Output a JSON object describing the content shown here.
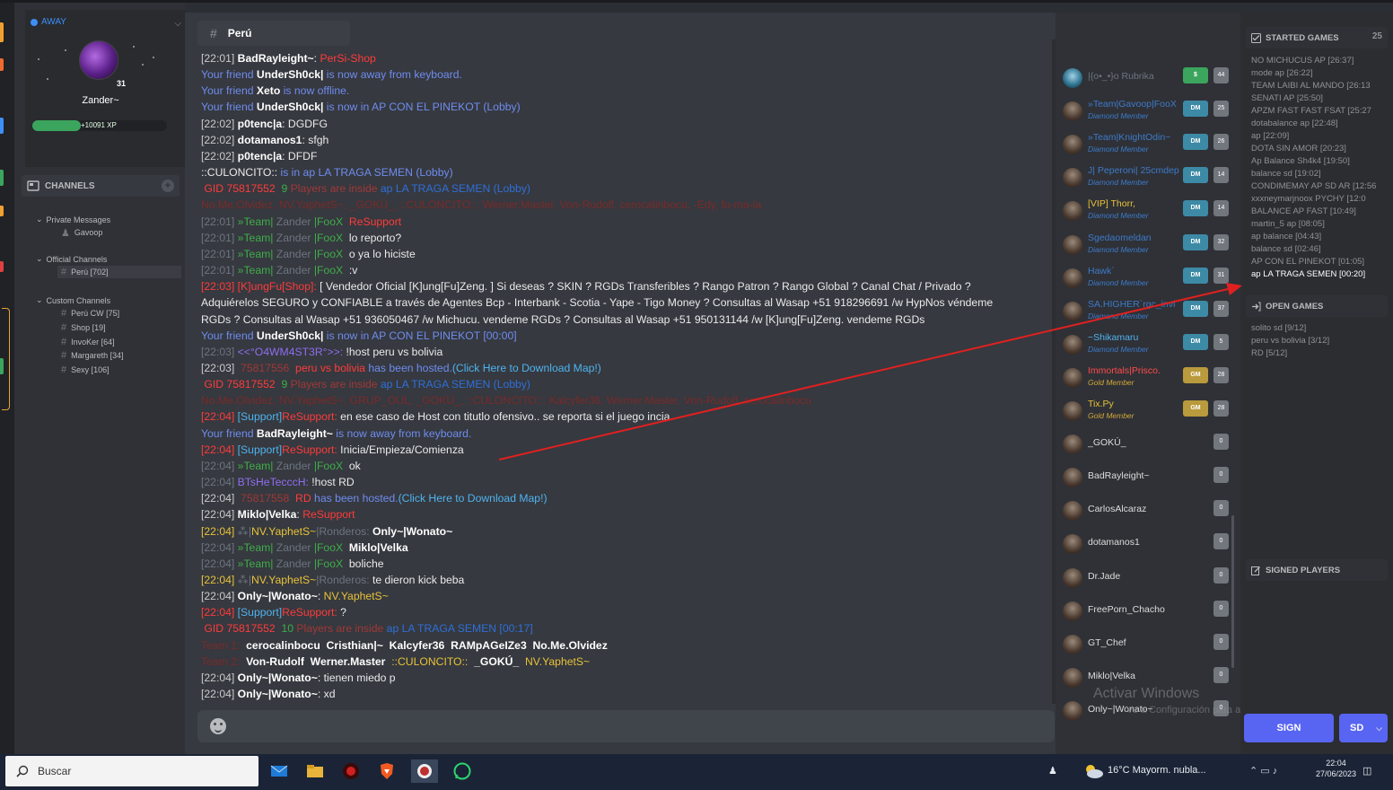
{
  "user": {
    "status": "AWAY",
    "name": "Zander~",
    "level": "31",
    "xp_text": "+10091 XP",
    "xp_fraction": 0.36
  },
  "sidebar": {
    "channels_label": "CHANNELS",
    "private_label": "Private Messages",
    "private_items": [
      {
        "label": "Gavoop"
      }
    ],
    "official_label": "Official Channels",
    "official_items": [
      {
        "label": "Perú [702]"
      }
    ],
    "custom_label": "Custom Channels",
    "custom_items": [
      {
        "label": "Perú CW [75]"
      },
      {
        "label": "Shop [19]"
      },
      {
        "label": "InvoKer [64]"
      },
      {
        "label": "Margareth [34]"
      },
      {
        "label": "Sexy [106]"
      }
    ]
  },
  "chat": {
    "channel_name": "Perú",
    "lines": [
      [
        {
          "t": "[22:01] ",
          "c": "c-time"
        },
        {
          "t": "BadRayleight~",
          "c": "c-bold"
        },
        {
          "t": ": ",
          "c": "c-white"
        },
        {
          "t": "PerSi-Shop",
          "c": "c-red"
        }
      ],
      [
        {
          "t": "Your friend ",
          "c": "c-blue"
        },
        {
          "t": "UnderSh0ck|",
          "c": "c-bold"
        },
        {
          "t": " is now away from keyboard.",
          "c": "c-blue"
        }
      ],
      [
        {
          "t": "Your friend ",
          "c": "c-blue"
        },
        {
          "t": "Xeto",
          "c": "c-bold"
        },
        {
          "t": " is now offline.",
          "c": "c-blue"
        }
      ],
      [
        {
          "t": "Your friend ",
          "c": "c-blue"
        },
        {
          "t": "UnderSh0ck|",
          "c": "c-bold"
        },
        {
          "t": " is now in AP CON EL PINEKOT (Lobby)",
          "c": "c-blue"
        }
      ],
      [
        {
          "t": "[22:02] ",
          "c": "c-time"
        },
        {
          "t": "p0tenc|a",
          "c": "c-bold"
        },
        {
          "t": ": DGDFG",
          "c": "c-white"
        }
      ],
      [
        {
          "t": "[22:02] ",
          "c": "c-time"
        },
        {
          "t": "dotamanos1",
          "c": "c-bold"
        },
        {
          "t": ": sfgh",
          "c": "c-white"
        }
      ],
      [
        {
          "t": "[22:02] ",
          "c": "c-time"
        },
        {
          "t": "p0tenc|a",
          "c": "c-bold"
        },
        {
          "t": ": DFDF",
          "c": "c-white"
        }
      ],
      [
        {
          "t": "::CULONCITO::",
          "c": "c-white"
        },
        {
          "t": " is in ap LA TRAGA SEMEN (Lobby)",
          "c": "c-blue"
        }
      ],
      [
        {
          "t": " GID 75817552 ",
          "c": "c-red"
        },
        {
          "t": " 9 ",
          "c": "c-green"
        },
        {
          "t": "Players are inside ",
          "c": "c-dimred"
        },
        {
          "t": "ap LA TRAGA SEMEN (Lobby)",
          "c": "c-dblue"
        }
      ],
      [
        {
          "t": "No.Me.Olvidez, NV.YaphetS~, _GOKÚ_, ::CULONCITO::, Werner.Master, Von-Rudolf, cerocalinbocu, -Edy, fu-ma-ia",
          "c": "c-darkred"
        }
      ],
      [
        {
          "t": "[22:01] ",
          "c": "c-dim"
        },
        {
          "t": "»Team|",
          "c": "c-green"
        },
        {
          "t": " Zander ",
          "c": "c-dim"
        },
        {
          "t": "|FooX ",
          "c": "c-green"
        },
        {
          "t": " ReSupport",
          "c": "c-red"
        }
      ],
      [
        {
          "t": "[22:01] ",
          "c": "c-dim"
        },
        {
          "t": "»Team|",
          "c": "c-green"
        },
        {
          "t": " Zander ",
          "c": "c-dim"
        },
        {
          "t": "|FooX ",
          "c": "c-green"
        },
        {
          "t": " lo reporto?",
          "c": "c-white"
        }
      ],
      [
        {
          "t": "[22:01] ",
          "c": "c-dim"
        },
        {
          "t": "»Team|",
          "c": "c-green"
        },
        {
          "t": " Zander ",
          "c": "c-dim"
        },
        {
          "t": "|FooX ",
          "c": "c-green"
        },
        {
          "t": " o ya lo hiciste",
          "c": "c-white"
        }
      ],
      [
        {
          "t": "[22:01] ",
          "c": "c-dim"
        },
        {
          "t": "»Team|",
          "c": "c-green"
        },
        {
          "t": " Zander ",
          "c": "c-dim"
        },
        {
          "t": "|FooX ",
          "c": "c-green"
        },
        {
          "t": " :v",
          "c": "c-white"
        }
      ],
      [
        {
          "t": "[22:03] ",
          "c": "c-red"
        },
        {
          "t": "[K]ungFu[Shop]:",
          "c": "c-red"
        },
        {
          "t": " [ Vendedor Oficial [K]ung[Fu]Zeng. ] Si deseas ? SKIN ? RGDs Transferibles ? Rango Patron ? Rango Global ? Canal Chat / Privado ?",
          "c": "c-white"
        }
      ],
      [
        {
          "t": "Adquiérelos SEGURO y CONFIABLE a través de Agentes Bcp - Interbank - Scotia - Yape - Tigo Money ? Consultas al Wasap +51 918296691 /w HypNos véndeme",
          "c": "c-white"
        }
      ],
      [
        {
          "t": "RGDs ? Consultas al Wasap +51 936050467 /w Michucu. vendeme RGDs ? Consultas al Wasap +51 950131144 /w [K]ung[Fu]Zeng. vendeme RGDs",
          "c": "c-white"
        }
      ],
      [
        {
          "t": "Your friend ",
          "c": "c-blue"
        },
        {
          "t": "UnderSh0ck|",
          "c": "c-bold"
        },
        {
          "t": " is now in AP CON EL PINEKOT [00:00]",
          "c": "c-blue"
        }
      ],
      [
        {
          "t": "[22:03] ",
          "c": "c-dim"
        },
        {
          "t": "<<°O4WM4ST3R°>>:",
          "c": "c-purple"
        },
        {
          "t": " !host peru vs bolivia",
          "c": "c-white"
        }
      ],
      [
        {
          "t": "[22:03] ",
          "c": "c-time"
        },
        {
          "t": " 75817556 ",
          "c": "c-dimred"
        },
        {
          "t": " peru vs bolivia",
          "c": "c-red"
        },
        {
          "t": " has been hosted.",
          "c": "c-blue"
        },
        {
          "t": "(Click Here to Download Map!)",
          "c": "c-lblue"
        }
      ],
      [
        {
          "t": " GID 75817552 ",
          "c": "c-red"
        },
        {
          "t": " 9 ",
          "c": "c-green"
        },
        {
          "t": "Players are inside ",
          "c": "c-dimred"
        },
        {
          "t": "ap LA TRAGA SEMEN (Lobby)",
          "c": "c-dblue"
        }
      ],
      [
        {
          "t": "No.Me.Olvidez, NV.YaphetS~, GRUP_OUL, _GOKÚ_, ::CULONCITO::, Kalcyfer36, Werner.Master, Von-Rudolf, cerocalinbocu",
          "c": "c-darkred"
        }
      ],
      [
        {
          "t": "[22:04] ",
          "c": "c-red"
        },
        {
          "t": "[Support]",
          "c": "c-lblue"
        },
        {
          "t": "ReSupport:",
          "c": "c-red"
        },
        {
          "t": " en ese caso de Host con titutlo ofensivo.. se reporta si el juego incia.",
          "c": "c-white"
        }
      ],
      [
        {
          "t": "Your friend ",
          "c": "c-blue"
        },
        {
          "t": "BadRayleight~",
          "c": "c-bold"
        },
        {
          "t": " is now away from keyboard.",
          "c": "c-blue"
        }
      ],
      [
        {
          "t": "[22:04] ",
          "c": "c-red"
        },
        {
          "t": "[Support]",
          "c": "c-lblue"
        },
        {
          "t": "ReSupport:",
          "c": "c-red"
        },
        {
          "t": " Inicia/Empieza/Comienza",
          "c": "c-white"
        }
      ],
      [
        {
          "t": "[22:04] ",
          "c": "c-dim"
        },
        {
          "t": "»Team|",
          "c": "c-green"
        },
        {
          "t": " Zander ",
          "c": "c-dim"
        },
        {
          "t": "|FooX ",
          "c": "c-green"
        },
        {
          "t": " ok",
          "c": "c-white"
        }
      ],
      [
        {
          "t": "[22:04] ",
          "c": "c-dim"
        },
        {
          "t": "BTsHeTecccH:",
          "c": "c-purple"
        },
        {
          "t": " !host RD",
          "c": "c-white"
        }
      ],
      [
        {
          "t": "[22:04] ",
          "c": "c-time"
        },
        {
          "t": " 75817558 ",
          "c": "c-dimred"
        },
        {
          "t": " RD",
          "c": "c-red"
        },
        {
          "t": " has been hosted.",
          "c": "c-blue"
        },
        {
          "t": "(Click Here to Download Map!)",
          "c": "c-lblue"
        }
      ],
      [
        {
          "t": "[22:04] ",
          "c": "c-time"
        },
        {
          "t": "Miklo|Velka",
          "c": "c-bold"
        },
        {
          "t": ": ",
          "c": "c-white"
        },
        {
          "t": "ReSupport",
          "c": "c-red"
        }
      ],
      [
        {
          "t": "[22:04] ",
          "c": "c-yellow"
        },
        {
          "t": "⁂|",
          "c": "c-dim"
        },
        {
          "t": "NV.YaphetS~",
          "c": "c-yellow"
        },
        {
          "t": "|Ronderos: ",
          "c": "c-dim"
        },
        {
          "t": "Only~|Wonato~",
          "c": "c-bold"
        }
      ],
      [
        {
          "t": "[22:04] ",
          "c": "c-dim"
        },
        {
          "t": "»Team|",
          "c": "c-green"
        },
        {
          "t": " Zander ",
          "c": "c-dim"
        },
        {
          "t": "|FooX ",
          "c": "c-green"
        },
        {
          "t": " Miklo|Velka",
          "c": "c-bold"
        }
      ],
      [
        {
          "t": "[22:04] ",
          "c": "c-dim"
        },
        {
          "t": "»Team|",
          "c": "c-green"
        },
        {
          "t": " Zander ",
          "c": "c-dim"
        },
        {
          "t": "|FooX ",
          "c": "c-green"
        },
        {
          "t": " boliche",
          "c": "c-white"
        }
      ],
      [
        {
          "t": "[22:04] ",
          "c": "c-yellow"
        },
        {
          "t": "⁂|",
          "c": "c-dim"
        },
        {
          "t": "NV.YaphetS~",
          "c": "c-yellow"
        },
        {
          "t": "|Ronderos: ",
          "c": "c-dim"
        },
        {
          "t": "te dieron kick beba",
          "c": "c-white"
        }
      ],
      [
        {
          "t": "[22:04] ",
          "c": "c-time"
        },
        {
          "t": "Only~|Wonato~",
          "c": "c-bold"
        },
        {
          "t": ": ",
          "c": "c-white"
        },
        {
          "t": "NV.YaphetS~",
          "c": "c-yellow"
        }
      ],
      [
        {
          "t": "[22:04] ",
          "c": "c-red"
        },
        {
          "t": "[Support]",
          "c": "c-lblue"
        },
        {
          "t": "ReSupport:",
          "c": "c-red"
        },
        {
          "t": " ?",
          "c": "c-white"
        }
      ],
      [
        {
          "t": " GID 75817552 ",
          "c": "c-red"
        },
        {
          "t": " 10 ",
          "c": "c-green"
        },
        {
          "t": "Players are inside ",
          "c": "c-dimred"
        },
        {
          "t": "ap LA TRAGA SEMEN [00:17]",
          "c": "c-dblue"
        }
      ],
      [
        {
          "t": "Team 1: ",
          "c": "c-darkred"
        },
        {
          "t": " cerocalinbocu  Cristhian|~  Kalcyfer36  RAMpAGeIZe3  No.Me.Olvidez",
          "c": "c-bold"
        }
      ],
      [
        {
          "t": "Team 2: ",
          "c": "c-darkred"
        },
        {
          "t": " Von-Rudolf  Werner.Master  ",
          "c": "c-bold"
        },
        {
          "t": "::CULONCITO::",
          "c": "c-yellow"
        },
        {
          "t": "  _GOKÚ_  ",
          "c": "c-bold"
        },
        {
          "t": "NV.YaphetS~",
          "c": "c-yellow"
        }
      ],
      [
        {
          "t": "[22:04] ",
          "c": "c-time"
        },
        {
          "t": "Only~|Wonato~",
          "c": "c-bold"
        },
        {
          "t": ": tienen miedo p",
          "c": "c-white"
        }
      ],
      [
        {
          "t": "[22:04] ",
          "c": "c-time"
        },
        {
          "t": "Only~|Wonato~",
          "c": "c-bold"
        },
        {
          "t": ": xd",
          "c": "c-white"
        }
      ]
    ]
  },
  "members": [
    {
      "name": "|{o•_•}o Rubrika",
      "role": "",
      "name_color": "#6d7480",
      "badge": "$",
      "badge_style": "green",
      "count": "44",
      "avatar": "shield"
    },
    {
      "name": "»Team|Gavoop|FooX",
      "role": "Diamond Member",
      "name_color": "#3d7ac9",
      "badge": "DM",
      "badge_style": "",
      "count": "25"
    },
    {
      "name": "»Team|KnightOdin~",
      "role": "Diamond Member",
      "name_color": "#3d7ac9",
      "badge": "DM",
      "badge_style": "",
      "count": "26"
    },
    {
      "name": "J| Peperoni| 25cmdep",
      "role": "Diamond Member",
      "name_color": "#3d7ac9",
      "badge": "DM",
      "badge_style": "",
      "count": "14"
    },
    {
      "name": "[VIP] Thorr,",
      "role": "Diamond Member",
      "name_color": "#e8c23a",
      "badge": "DM",
      "badge_style": "",
      "count": "14"
    },
    {
      "name": "Sgedaomeldan",
      "role": "Diamond Member",
      "name_color": "#3d7ac9",
      "badge": "DM",
      "badge_style": "",
      "count": "32"
    },
    {
      "name": "Hawk`",
      "role": "Diamond Member",
      "name_color": "#3d7ac9",
      "badge": "DM",
      "badge_style": "",
      "count": "31"
    },
    {
      "name": "SA.HIGHER`rgc_invi",
      "role": "Diamond Member",
      "name_color": "#3d7ac9",
      "badge": "DM",
      "badge_style": "",
      "count": "37"
    },
    {
      "name": "~Shikamaru",
      "role": "Diamond Member",
      "name_color": "#4fb3f0",
      "badge": "DM",
      "badge_style": "",
      "count": "5"
    },
    {
      "name": "Immortals|Prisco.",
      "role": "Gold Member",
      "name_color": "#ff4a4a",
      "badge": "GM",
      "badge_style": "gold",
      "count": "28"
    },
    {
      "name": "Tix.Py",
      "role": "Gold Member",
      "name_color": "#e8c23a",
      "badge": "GM",
      "badge_style": "gold",
      "count": "28"
    },
    {
      "name": "_GOKÚ_",
      "role": "",
      "name_color": "#dcddde",
      "badge": "",
      "badge_style": "",
      "count": "0"
    },
    {
      "name": "BadRayleight~",
      "role": "",
      "name_color": "#dcddde",
      "badge": "",
      "badge_style": "",
      "count": "0"
    },
    {
      "name": "CarlosAlcaraz",
      "role": "",
      "name_color": "#dcddde",
      "badge": "",
      "badge_style": "",
      "count": "0"
    },
    {
      "name": "dotamanos1",
      "role": "",
      "name_color": "#dcddde",
      "badge": "",
      "badge_style": "",
      "count": "0"
    },
    {
      "name": "Dr.Jade",
      "role": "",
      "name_color": "#dcddde",
      "badge": "",
      "badge_style": "",
      "count": "0"
    },
    {
      "name": "FreePorn_Chacho",
      "role": "",
      "name_color": "#dcddde",
      "badge": "",
      "badge_style": "",
      "count": "0"
    },
    {
      "name": "GT_Chef",
      "role": "",
      "name_color": "#dcddde",
      "badge": "",
      "badge_style": "",
      "count": "0"
    },
    {
      "name": "Miklo|Velka",
      "role": "",
      "name_color": "#dcddde",
      "badge": "",
      "badge_style": "",
      "count": "0"
    },
    {
      "name": "Only~|Wonato~",
      "role": "",
      "name_color": "#dcddde",
      "badge": "",
      "badge_style": "",
      "count": "0"
    }
  ],
  "watermark": {
    "line1": "Activar Windows",
    "line2": "Ve a Configuración para activar Windows."
  },
  "games": {
    "started_label": "STARTED GAMES",
    "started_count": "25",
    "started": [
      "NO MICHUCUS AP [26:37]",
      "mode ap [26:22]",
      "TEAM LAIBI AL MANDO [26:13",
      "SENATI AP [25:50]",
      "APZM FAST FAST FSAT [25:27",
      "dotabalance ap [22:48]",
      "ap [22:09]",
      "DOTA SIN AMOR [20:23]",
      "Ap Balance Sh4k4 [19:50]",
      "balance sd [19:02]",
      "CONDIMEMAY AP SD AR [12:56",
      "xxxneymarjnoox PYCHY [12:0",
      "BALANCE AP FAST [10:49]",
      "martin_5 ap [08:05]",
      "ap balance [04:43]",
      "balance sd [02:46]",
      "AP CON EL PINEKOT [01:05]",
      "ap LA TRAGA SEMEN [00:20]"
    ],
    "open_label": "OPEN GAMES",
    "open": [
      "solito sd [9/12]",
      "peru vs bolivia [3/12]",
      "RD [5/12]"
    ],
    "signed_label": "SIGNED PLAYERS",
    "sign_label": "SIGN",
    "sd_label": "SD"
  },
  "taskbar": {
    "search_placeholder": "Buscar",
    "weather": "16°C  Mayorm. nubla...",
    "time": "22:04",
    "date": "27/06/2023"
  },
  "colors": {
    "accent": "#5865f2",
    "arrow": "#e02020",
    "xp": "#3ba55d"
  }
}
